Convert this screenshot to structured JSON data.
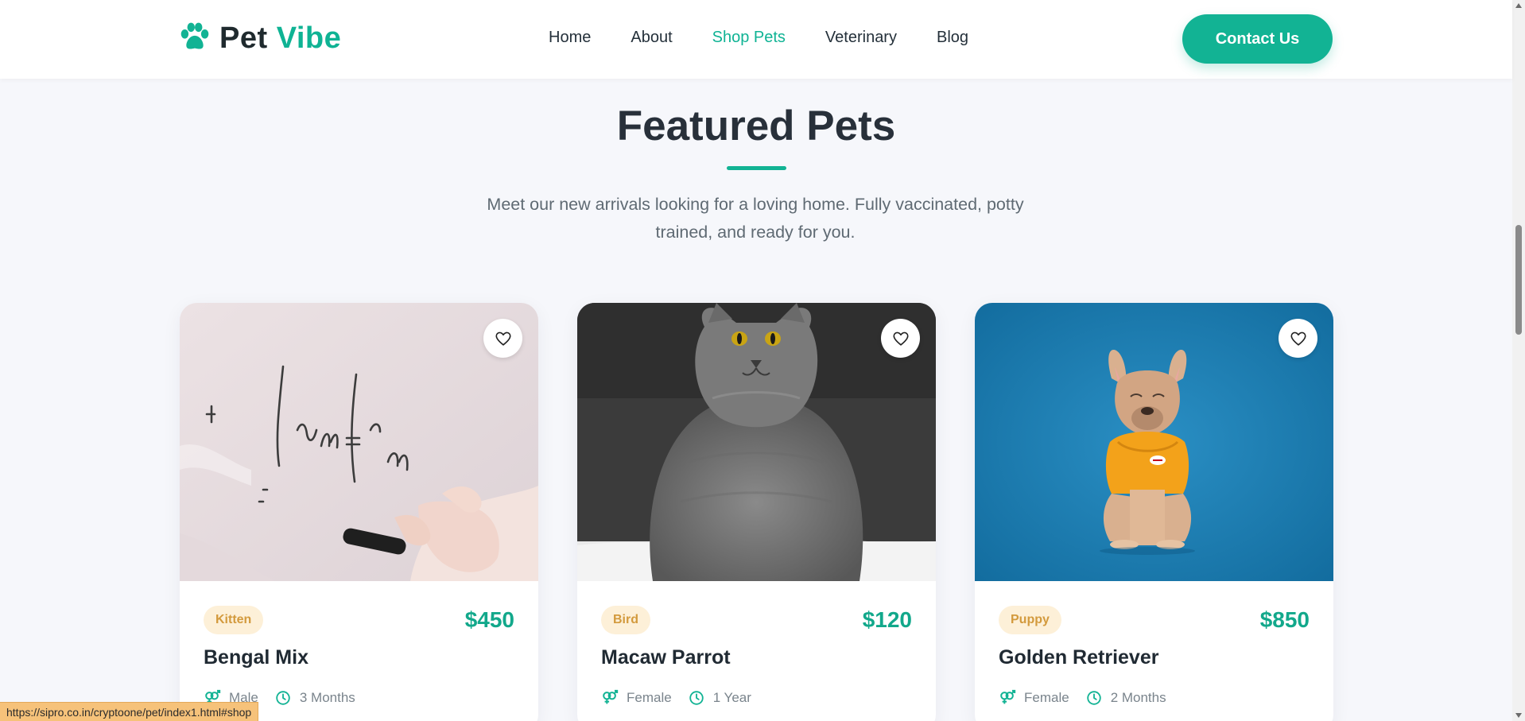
{
  "brand": {
    "part1": "Pet",
    "part2": "Vibe"
  },
  "nav": [
    {
      "label": "Home"
    },
    {
      "label": "About"
    },
    {
      "label": "Shop Pets",
      "active": true
    },
    {
      "label": "Veterinary"
    },
    {
      "label": "Blog"
    }
  ],
  "header": {
    "contact_label": "Contact Us"
  },
  "section": {
    "title": "Featured Pets",
    "subtitle": "Meet our new arrivals looking for a loving home. Fully vaccinated, potty trained, and ready for you."
  },
  "cards": [
    {
      "tag": "Kitten",
      "price": "$450",
      "name": "Bengal Mix",
      "gender": "Male",
      "age": "3 Months"
    },
    {
      "tag": "Bird",
      "price": "$120",
      "name": "Macaw Parrot",
      "gender": "Female",
      "age": "1 Year"
    },
    {
      "tag": "Puppy",
      "price": "$850",
      "name": "Golden Retriever",
      "gender": "Female",
      "age": "2 Months"
    }
  ],
  "status_url": "https://sipro.co.in/cryptoone/pet/index1.html#shop",
  "colors": {
    "accent": "#12b394",
    "tag_bg": "#fdf0d8",
    "tag_text": "#d39a3d",
    "page_bg": "#f6f7fb"
  },
  "icons": {
    "logo": "paw-icon",
    "favorite": "heart-icon",
    "gender": "gender-icon",
    "age": "clock-icon"
  }
}
